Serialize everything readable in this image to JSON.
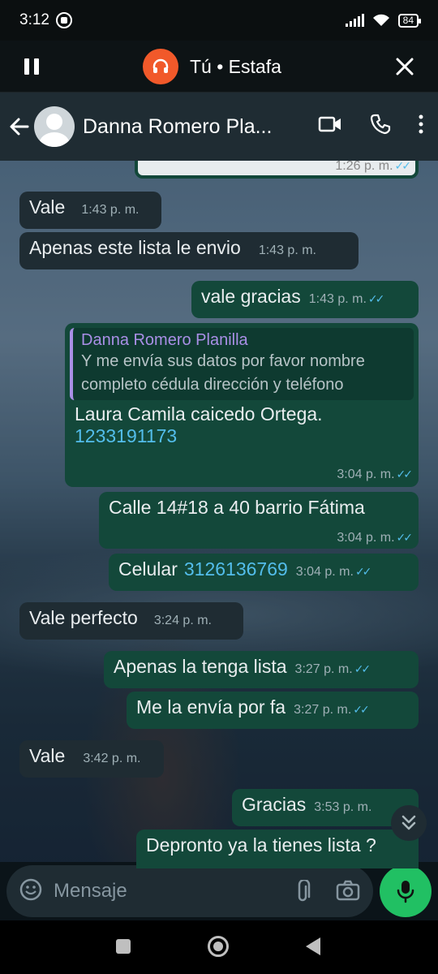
{
  "status_bar": {
    "time": "3:12",
    "battery": "84"
  },
  "call_banner": {
    "title": "Tú • Estafa"
  },
  "chat_header": {
    "contact_name": "Danna Romero Pla..."
  },
  "messages": [
    {
      "id": "m0",
      "direction": "out",
      "text": "",
      "time": "1:26 p. m.",
      "ticks": "✓✓"
    },
    {
      "id": "m1",
      "direction": "in",
      "text": "Vale",
      "time": "1:43 p. m."
    },
    {
      "id": "m2",
      "direction": "in",
      "text": "Apenas este lista le envio",
      "time": "1:43 p. m."
    },
    {
      "id": "m3",
      "direction": "out",
      "text": "vale gracias",
      "time": "1:43 p. m.",
      "ticks": "✓✓"
    },
    {
      "id": "m4",
      "direction": "out",
      "quote_author": "Danna Romero Planilla",
      "quote_text": "Y me envía sus datos por favor nombre completo cédula dirección y teléfono",
      "text": "Laura Camila caicedo Ortega.",
      "link": "1233191173",
      "time": "3:04 p. m.",
      "ticks": "✓✓"
    },
    {
      "id": "m5",
      "direction": "out",
      "text": "Calle 14#18 a 40 barrio Fátima",
      "time": "3:04 p. m.",
      "ticks": "✓✓"
    },
    {
      "id": "m6",
      "direction": "out",
      "text": "Celular",
      "link": "3126136769",
      "time": "3:04 p. m.",
      "ticks": "✓✓"
    },
    {
      "id": "m7",
      "direction": "in",
      "text": "Vale perfecto",
      "time": "3:24 p. m."
    },
    {
      "id": "m8",
      "direction": "out",
      "text": "Apenas la tenga lista",
      "time": "3:27 p. m.",
      "ticks": "✓✓"
    },
    {
      "id": "m9",
      "direction": "out",
      "text": "Me la envía por fa",
      "time": "3:27 p. m.",
      "ticks": "✓✓"
    },
    {
      "id": "m10",
      "direction": "in",
      "text": "Vale",
      "time": "3:42 p. m."
    },
    {
      "id": "m11",
      "direction": "out",
      "text": "Gracias",
      "time": "3:53 p. m."
    },
    {
      "id": "m12",
      "direction": "out",
      "text": "Depronto ya la tienes lista ?"
    }
  ],
  "input": {
    "placeholder": "Mensaje"
  },
  "icons": {
    "status": [
      "whatsapp-icon",
      "signal-icon",
      "wifi-icon",
      "battery-icon"
    ],
    "call": [
      "pause-icon",
      "headset-icon",
      "close-icon"
    ],
    "header": [
      "back-arrow-icon",
      "avatar",
      "video-call-icon",
      "phone-icon",
      "more-vert-icon"
    ],
    "input": [
      "emoji-icon",
      "attach-icon",
      "camera-icon",
      "mic-icon"
    ]
  },
  "colors": {
    "accent_green": "#21c063",
    "link_blue": "#53bdeb",
    "quote_purple": "#a98fe6",
    "call_orange": "#f1592a"
  }
}
